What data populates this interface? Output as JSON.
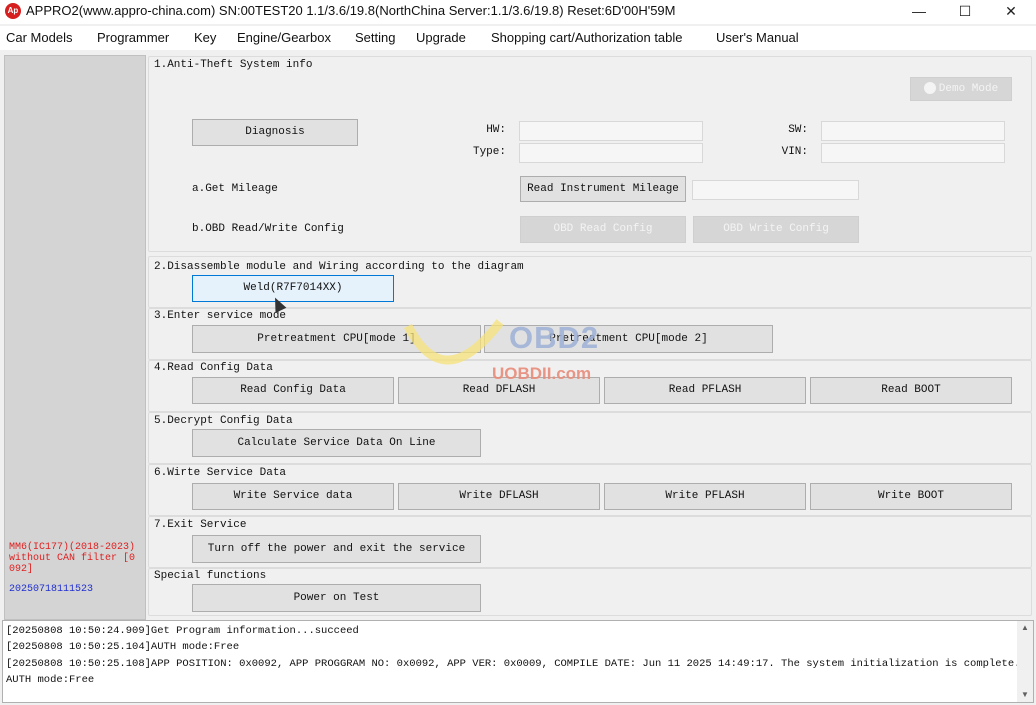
{
  "window": {
    "title": "APPRO2(www.appro-china.com)  SN:00TEST20  1.1/3.6/19.8(NorthChina Server:1.1/3.6/19.8)  Reset:6D'00H'59M",
    "logo": "Ap",
    "minimize": "—",
    "maximize": "☐",
    "close": "✕"
  },
  "menu": [
    "Car Models",
    "Programmer",
    "Key",
    "Engine/Gearbox",
    "Setting",
    "Upgrade",
    "Shopping cart/Authorization table",
    "User's Manual"
  ],
  "left": {
    "model": "MM6(IC177)(2018-2023) without CAN filter [0092]",
    "build": "20250718111523"
  },
  "sections": {
    "s1": {
      "title": "1.Anti-Theft System info",
      "demo_mode": "Demo Mode",
      "diagnosis": "Diagnosis",
      "hw_label": "HW:",
      "type_label": "Type:",
      "sw_label": "SW:",
      "vin_label": "VIN:",
      "hw": "",
      "type": "",
      "sw": "",
      "vin": "",
      "get_mileage": "a.Get Mileage",
      "read_mileage": "Read Instrument Mileage",
      "mileage_value": "",
      "obd_label": "b.OBD Read/Write Config",
      "obd_read": "OBD Read Config",
      "obd_write": "OBD Write Config"
    },
    "s2": {
      "title": "2.Disassemble module and Wiring according to the diagram",
      "weld": "Weld(R7F7014XX)"
    },
    "s3": {
      "title": "3.Enter service mode",
      "mode1": "Pretreatment CPU[mode 1]",
      "mode2": "Pretreatment CPU[mode 2]"
    },
    "s4": {
      "title": "4.Read Config Data",
      "read_config": "Read Config Data",
      "read_dflash": "Read DFLASH",
      "read_pflash": "Read PFLASH",
      "read_boot": "Read BOOT"
    },
    "s5": {
      "title": "5.Decrypt Config Data",
      "calc": "Calculate Service Data On Line"
    },
    "s6": {
      "title": "6.Wirte Service Data",
      "write_service": "Write Service data",
      "write_dflash": "Write DFLASH",
      "write_pflash": "Write PFLASH",
      "write_boot": "Write BOOT"
    },
    "s7": {
      "title": "7.Exit Service",
      "turn_off": "Turn off the power and exit the service"
    },
    "special": {
      "title": "Special functions",
      "power_test": "Power on Test"
    }
  },
  "watermark": {
    "logo": "OBD2",
    "site": "UOBDII.com"
  },
  "log": [
    "[20250808 10:50:24.909]Get Program information...succeed",
    "[20250808 10:50:25.104]AUTH mode:Free",
    "[20250808 10:50:25.108]APP POSITION: 0x0092, APP PROGGRAM NO: 0x0092, APP VER: 0x0009, COMPILE DATE: Jun 11 2025 14:49:17. The system initialization is complete.",
    "AUTH mode:Free"
  ]
}
